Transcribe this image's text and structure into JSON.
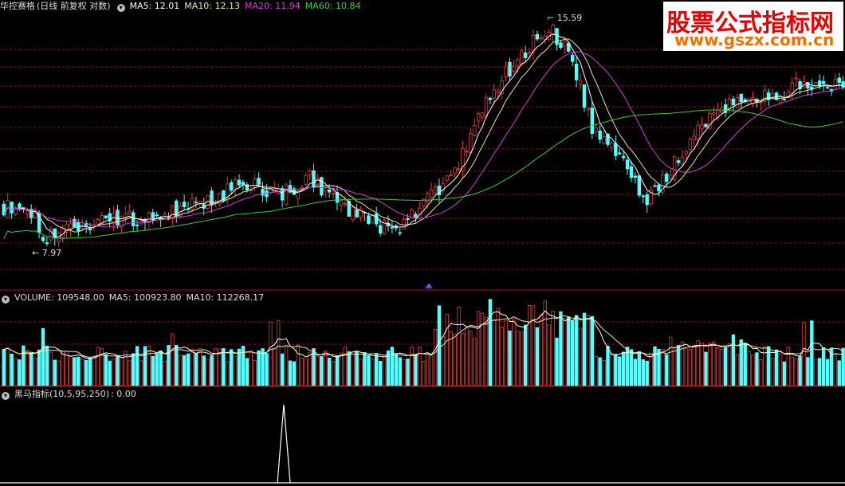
{
  "main_panel": {
    "title": "华控赛格",
    "mode": "(日线 前复权 对数)",
    "ma5": "MA5: 12.01",
    "ma10": "MA10: 12.13",
    "ma20": "MA20: 11.94",
    "ma60": "MA60: 10.84",
    "high_label": "15.59",
    "low_label": "7.97",
    "high_value": 15.59,
    "low_value": 7.97
  },
  "volume_panel": {
    "volume": "VOLUME: 109548.00",
    "ma5": "MA5: 100923.80",
    "ma10": "MA10: 112268.17"
  },
  "indicator_panel": {
    "name": "黑马指标(10,5,95,250)",
    "value": ": 0.00"
  },
  "watermark": {
    "title": "股票公式指标网",
    "url": "www.gszx.com.cn"
  },
  "colors": {
    "background": "#000000",
    "up_candle": "#e03c3c",
    "down_candle": "#54ffff",
    "ma5": "#ffffff",
    "ma10": "#e8e8a0",
    "ma20": "#d040d0",
    "ma60": "#3cc83c",
    "grid": "#7a1a1a",
    "separator": "#c00000"
  }
}
